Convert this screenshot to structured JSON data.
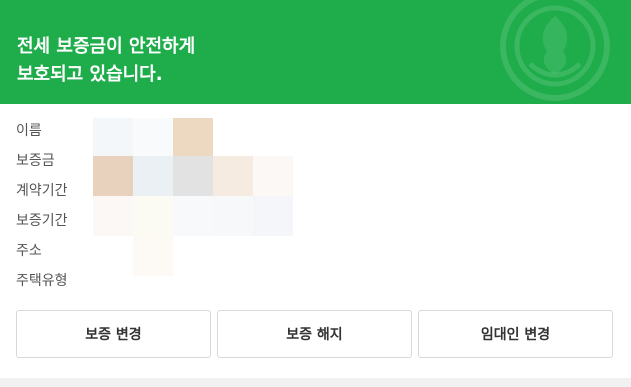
{
  "header": {
    "title_line1": "전세 보증금이 안전하게",
    "title_line2": "보호되고 있습니다.",
    "emblem_icon": "shield-emblem-icon",
    "background_color": "#1fad4b"
  },
  "info": {
    "labels": [
      "이름",
      "보증금",
      "계약기간",
      "보증기간",
      "주소",
      "주택유형"
    ]
  },
  "actions": {
    "change_label": "보증 변경",
    "cancel_label": "보증 해지",
    "landlord_change_label": "임대인 변경"
  }
}
